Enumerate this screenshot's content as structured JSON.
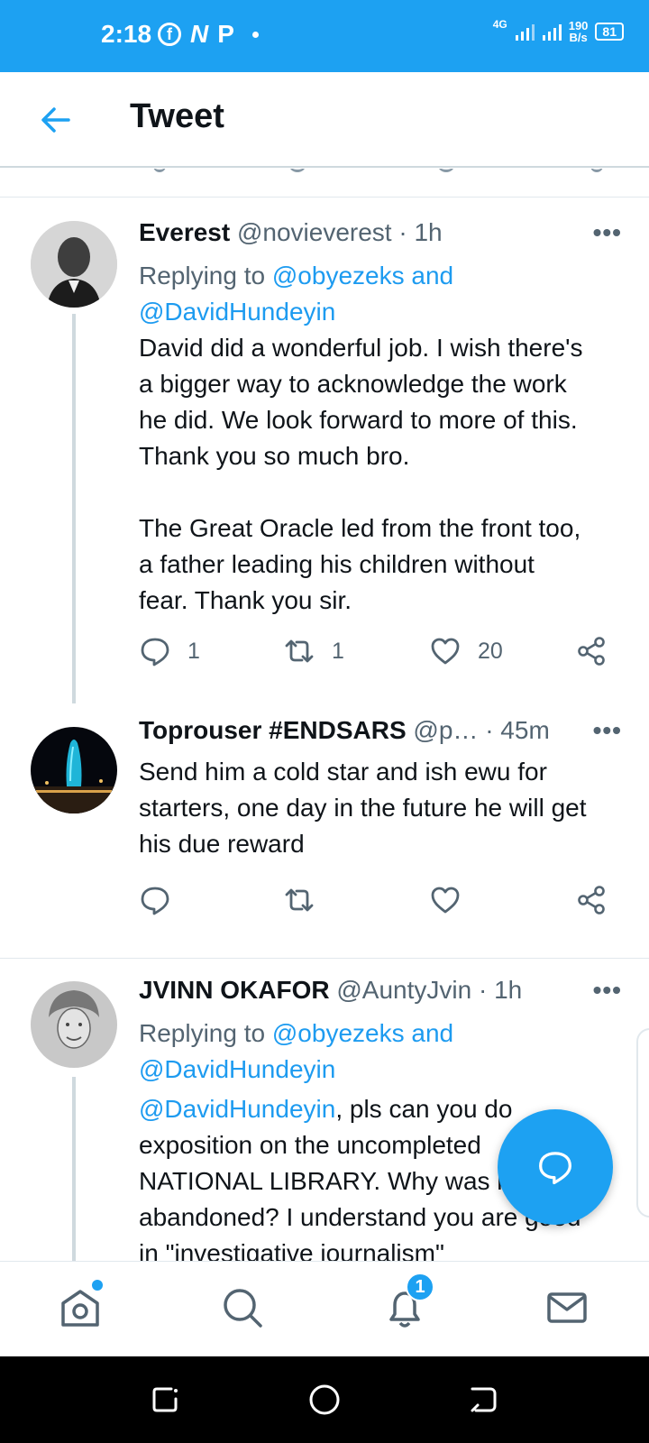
{
  "status_bar": {
    "time": "2:18",
    "network": "4G",
    "speed_value": "190",
    "speed_unit": "B/s",
    "battery": "81",
    "app_icon_n": "N",
    "app_icon_p": "P"
  },
  "header": {
    "title": "Tweet",
    "back_icon": "arrow-left-icon"
  },
  "tweets": [
    {
      "name": "Everest",
      "handle": "@novieverest",
      "time": "· 1h",
      "replying_prefix": "Replying to ",
      "replying_users": "@obyezeks and",
      "replying_users_2": "@DavidHundeyin",
      "text": "David did a wonderful job. I wish there's\na bigger way to acknowledge the work\nhe did. We look forward to more of this.\nThank you so much bro.\n\nThe Great Oracle led from the front too,\na father leading his children without\nfear. Thank you sir.",
      "replies": "1",
      "retweets": "1",
      "likes": "20"
    },
    {
      "name": "Toprouser #ENDSARS",
      "handle": "@p…",
      "time": "· 45m",
      "text": "Send him a cold star and ish ewu for\nstarters, one day in the future he will get\nhis due reward"
    },
    {
      "name": "JVINN OKAFOR",
      "handle": "@AuntyJvin",
      "time": "· 1h",
      "replying_prefix": "Replying to ",
      "replying_users": "@obyezeks and",
      "replying_users_2": "@DavidHundeyin",
      "mention": "@DavidHundeyin",
      "text_line1": ", pls can you do",
      "text_rest": "exposition on the uncompleted\nNATIONAL LIBRARY. Why was it\nabandoned? I understand you are good\nin \"investigative journalism\""
    }
  ],
  "more_label": "•••",
  "bottom_nav": {
    "notifications_badge": "1",
    "items": [
      "home-icon",
      "search-icon",
      "bell-icon",
      "mail-icon"
    ]
  },
  "colors": {
    "accent": "#1da1f2",
    "text": "#0f1419",
    "muted": "#536471"
  }
}
